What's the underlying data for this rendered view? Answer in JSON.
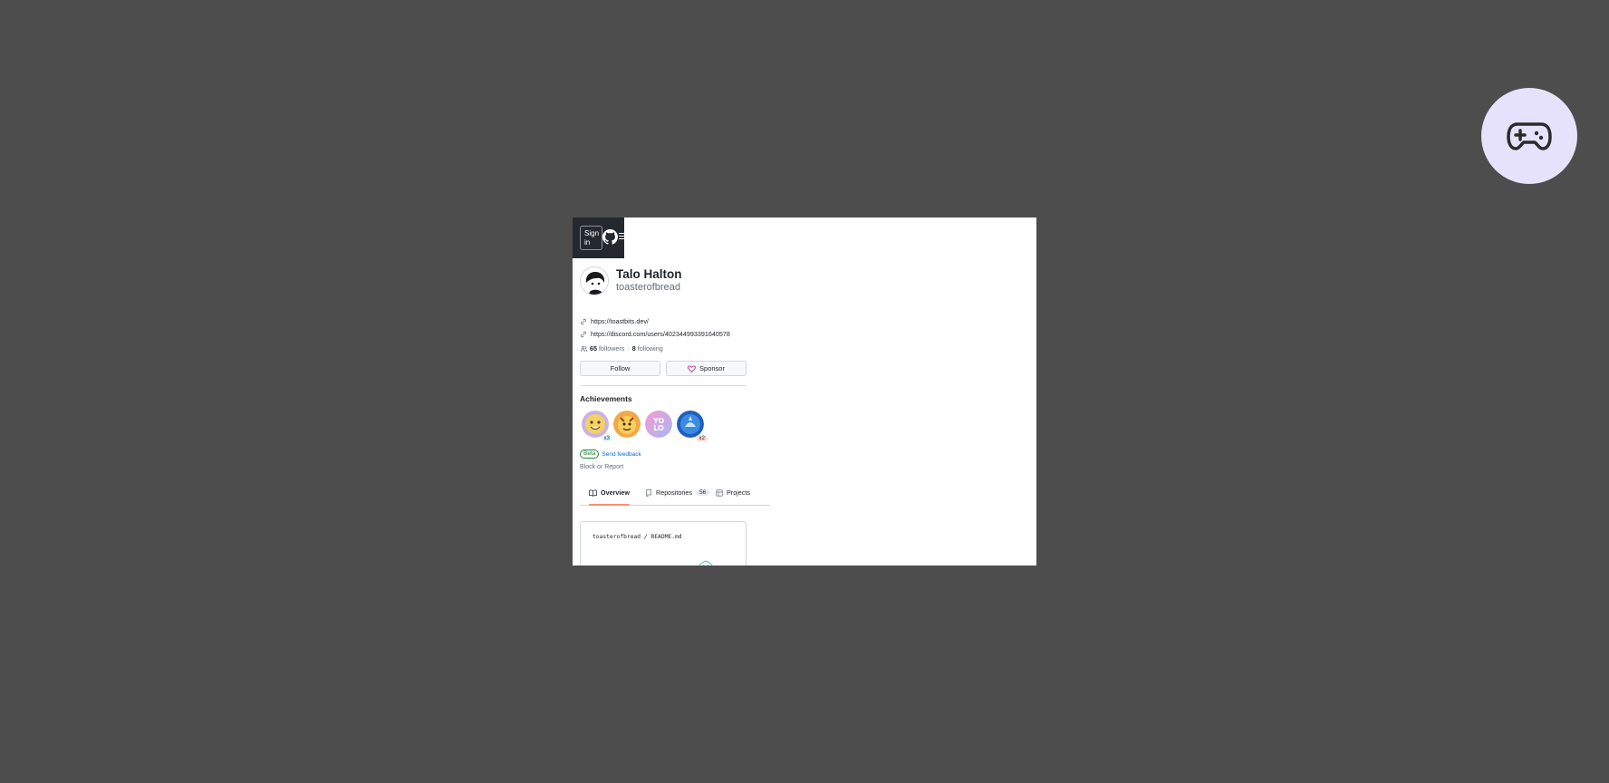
{
  "header": {
    "signin_label": "Sign in",
    "icons": [
      "github-logo-icon",
      "hamburger-menu-icon"
    ]
  },
  "overlay": {
    "icon": "gamepad-icon",
    "bg_color": "#e7e2fb"
  },
  "profile": {
    "name": "Talo Halton",
    "login": "toasterofbread",
    "links": [
      {
        "text": "https://toastbits.dev/"
      },
      {
        "text": "https://discord.com/users/402344993391640578"
      }
    ],
    "followers_count": "65",
    "followers_label": "followers",
    "separator": "·",
    "following_count": "8",
    "following_label": "following",
    "follow_label": "Follow",
    "sponsor_label": "Sponsor"
  },
  "achievements": {
    "title": "Achievements",
    "badges": [
      {
        "name": "badge-1",
        "count": "x3"
      },
      {
        "name": "badge-2",
        "count": ""
      },
      {
        "name": "badge-yolo",
        "count": ""
      },
      {
        "name": "badge-shark",
        "count": "x2"
      }
    ],
    "beta_label": "Beta",
    "feedback_label": "Send feedback"
  },
  "block_label": "Block or Report",
  "tabs": [
    {
      "label": "Overview",
      "active": true
    },
    {
      "label": "Repositories",
      "counter": "56"
    },
    {
      "label": "Projects"
    }
  ],
  "readme": {
    "path": "toasterofbread / README.md"
  },
  "colors": {
    "background": "#4d4d4d",
    "header": "#24292f",
    "accent_tab": "#fd8c73",
    "link": "#0969da",
    "beta": "#1a7f37"
  }
}
